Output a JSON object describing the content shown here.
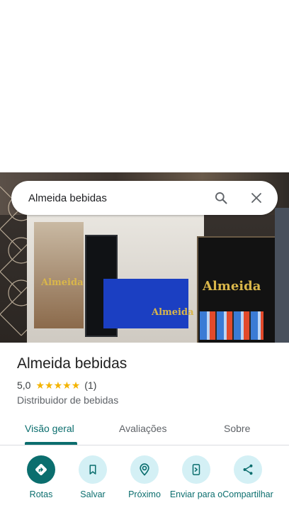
{
  "search": {
    "query": "Almeida bebidas"
  },
  "place": {
    "name": "Almeida bebidas",
    "rating": "5,0",
    "stars": 5,
    "review_count": "(1)",
    "category": "Distribuidor de bebidas"
  },
  "tabs": [
    {
      "label": "Visão geral",
      "active": true
    },
    {
      "label": "Avaliações",
      "active": false
    },
    {
      "label": "Sobre",
      "active": false
    }
  ],
  "actions": [
    {
      "label": "Rotas",
      "icon": "directions-icon"
    },
    {
      "label": "Salvar",
      "icon": "bookmark-icon"
    },
    {
      "label": "Próximo",
      "icon": "nearby-icon"
    },
    {
      "label": "Enviar para o",
      "icon": "send-to-phone-icon"
    },
    {
      "label": "Compartilhar",
      "icon": "share-icon"
    }
  ],
  "colors": {
    "accent": "#0b6e6e",
    "action_bg": "#d4f0f5",
    "star": "#f4b400"
  }
}
